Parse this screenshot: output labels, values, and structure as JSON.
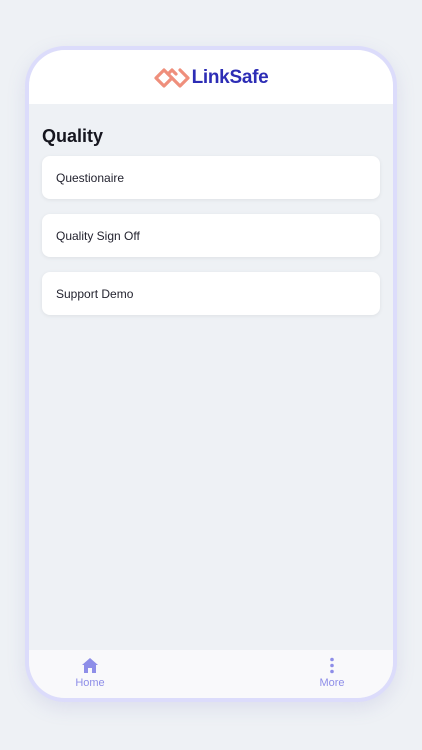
{
  "brand": {
    "logo_text": "LinkSafe",
    "logo_mark_icon": "chain-link-logo-icon",
    "colors": {
      "logo_mark": "#ef8f7c",
      "logo_text": "#2d2db5",
      "nav_accent": "#8e8ee8"
    }
  },
  "page": {
    "title": "Quality"
  },
  "menu": {
    "items": [
      {
        "label": "Questionaire"
      },
      {
        "label": "Quality Sign Off"
      },
      {
        "label": "Support Demo"
      }
    ]
  },
  "bottom_nav": {
    "home": {
      "label": "Home",
      "icon": "home-icon"
    },
    "more": {
      "label": "More",
      "icon": "more-vertical-icon"
    }
  }
}
